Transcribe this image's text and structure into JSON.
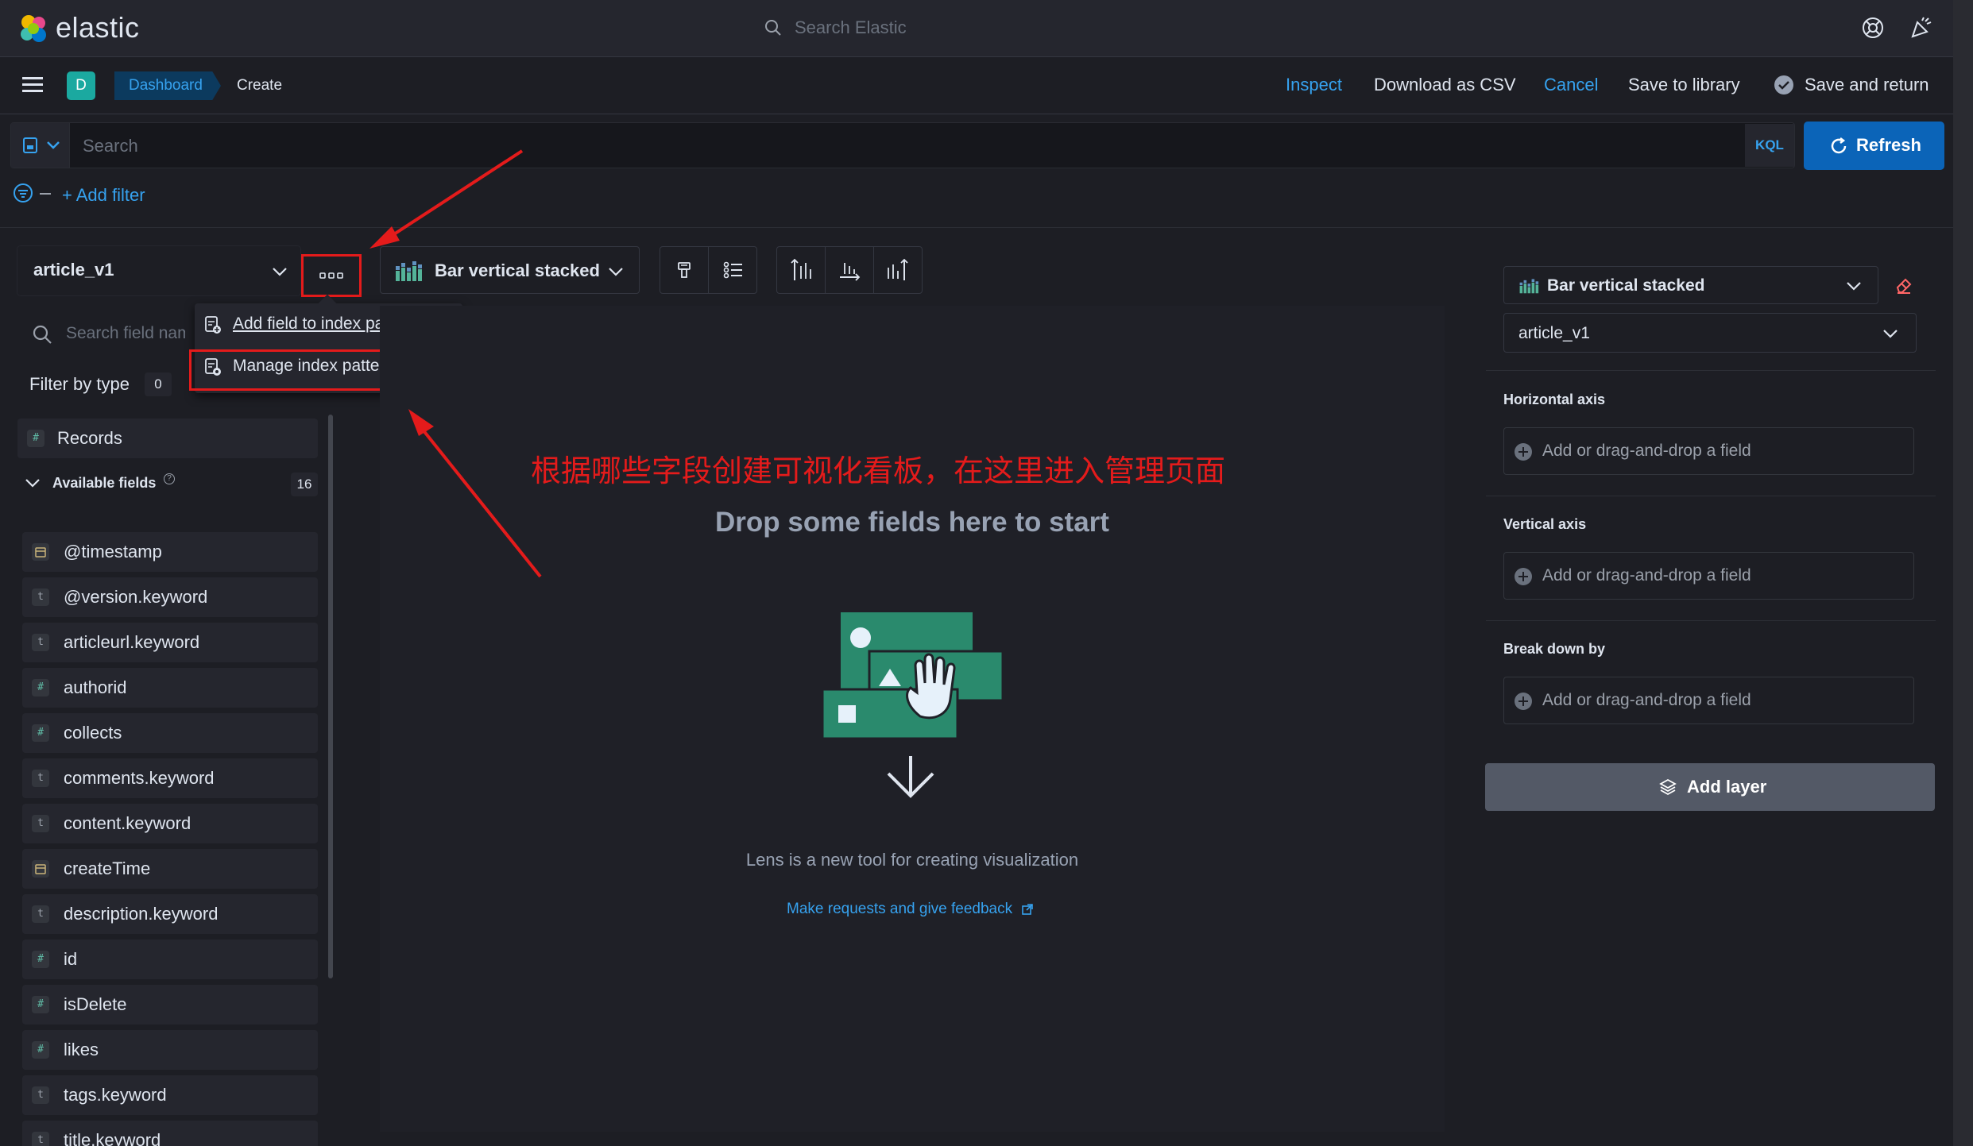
{
  "header": {
    "logo_text": "elastic",
    "search_placeholder": "Search Elastic"
  },
  "nav": {
    "space_avatar": "D",
    "breadcrumbs": [
      "Dashboard",
      "Create"
    ],
    "actions": {
      "inspect": "Inspect",
      "download_csv": "Download as CSV",
      "cancel": "Cancel",
      "save_to_library": "Save to library",
      "save_and_return": "Save and return"
    }
  },
  "query": {
    "placeholder": "Search",
    "language": "KQL",
    "refresh_label": "Refresh",
    "add_filter": "+ Add filter"
  },
  "left_panel": {
    "index_pattern": "article_v1",
    "field_search_placeholder": "Search field names",
    "filter_by_type_label": "Filter by type",
    "filter_by_type_count": "0",
    "records_label": "Records",
    "available_fields_label": "Available fields",
    "available_fields_count": "16",
    "fields": [
      {
        "type": "date",
        "name": "@timestamp"
      },
      {
        "type": "t",
        "name": "@version.keyword"
      },
      {
        "type": "t",
        "name": "articleurl.keyword"
      },
      {
        "type": "#",
        "name": "authorid"
      },
      {
        "type": "#",
        "name": "collects"
      },
      {
        "type": "t",
        "name": "comments.keyword"
      },
      {
        "type": "t",
        "name": "content.keyword"
      },
      {
        "type": "date",
        "name": "createTime"
      },
      {
        "type": "t",
        "name": "description.keyword"
      },
      {
        "type": "#",
        "name": "id"
      },
      {
        "type": "#",
        "name": "isDelete"
      },
      {
        "type": "#",
        "name": "likes"
      },
      {
        "type": "t",
        "name": "tags.keyword"
      },
      {
        "type": "t",
        "name": "title.keyword"
      }
    ]
  },
  "popover": {
    "add_field": "Add field to index pattern",
    "manage_fields": "Manage index pattern fields"
  },
  "toolbar": {
    "chart_type": "Bar vertical stacked"
  },
  "workspace": {
    "annotation": "根据哪些字段创建可视化看板，在这里进入管理页面",
    "drop_title": "Drop some fields here to start",
    "lens_description": "Lens is a new tool for creating visualization",
    "feedback_link": "Make requests and give feedback"
  },
  "config_panel": {
    "chart_type": "Bar vertical stacked",
    "index_pattern": "article_v1",
    "horizontal_axis": "Horizontal axis",
    "vertical_axis": "Vertical axis",
    "break_down_by": "Break down by",
    "dropzone_text": "Add or drag-and-drop a field",
    "add_layer": "Add layer"
  },
  "colors": {
    "accent_blue": "#36a2ef",
    "primary_button": "#0b64b8",
    "annotation_red": "#e41b1b",
    "illustration_green": "#2a8a6d"
  }
}
